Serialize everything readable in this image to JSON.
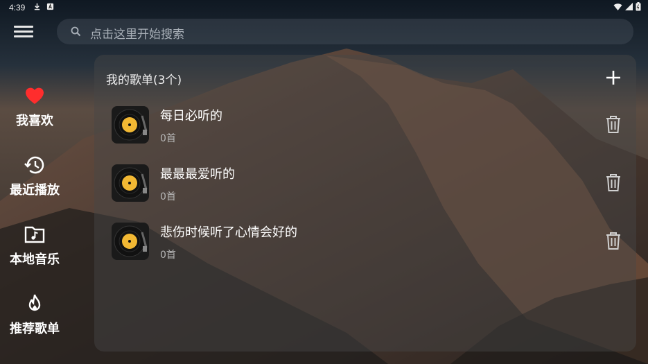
{
  "status_bar": {
    "time": "4:39"
  },
  "search": {
    "placeholder": "点击这里开始搜索"
  },
  "sidebar": {
    "items": [
      {
        "label": "我喜欢",
        "icon": "heart-icon"
      },
      {
        "label": "最近播放",
        "icon": "history-icon"
      },
      {
        "label": "本地音乐",
        "icon": "music-folder-icon"
      },
      {
        "label": "推荐歌单",
        "icon": "flame-icon"
      }
    ]
  },
  "panel": {
    "title": "我的歌单(3个)",
    "playlists": [
      {
        "name": "每日必听的",
        "count": "0首"
      },
      {
        "name": "最最最爱听的",
        "count": "0首"
      },
      {
        "name": "悲伤时候听了心情会好的",
        "count": "0首"
      }
    ]
  },
  "colors": {
    "heart": "#ff2d2d",
    "icon": "#ffffff",
    "panel_bg": "rgba(70,70,72,0.45)",
    "secondary_text": "#b8b8b8",
    "record_label": "#f2b833"
  }
}
